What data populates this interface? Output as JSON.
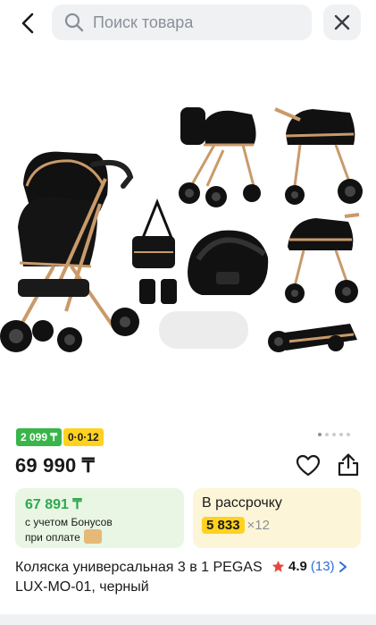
{
  "search": {
    "placeholder": "Поиск товара"
  },
  "icons": {
    "back": "chevron-left-icon",
    "search": "search-icon",
    "close": "close-icon",
    "favorite": "heart-icon",
    "share": "share-icon",
    "star": "star-icon",
    "rating_chevron": "chevron-right-icon",
    "bonus_coin": "bonus-coin-icon"
  },
  "gallery": {
    "image_count": 5,
    "active_index": 0
  },
  "badges": {
    "monthly_payment": "2 099 ₸",
    "installment_plan": "0·0·12"
  },
  "product": {
    "price": "69 990 ₸",
    "title": "Коляска универсальная 3 в 1 PEGAS LUX-MO-01, черный",
    "rating": "4.9",
    "reviews": "(13)"
  },
  "bonus": {
    "amount": "67 891 ₸",
    "line1": "с учетом Бонусов",
    "line2": "при оплате"
  },
  "installment": {
    "title": "В рассрочку",
    "amount": "5 833",
    "multiplier": "×12"
  },
  "colors": {
    "green": "#39b54a",
    "yellow": "#ffd21f",
    "bonus_bg": "#e9f6e4",
    "install_bg": "#fdf5d8",
    "link": "#2f6fd8",
    "star": "#e8453c"
  }
}
